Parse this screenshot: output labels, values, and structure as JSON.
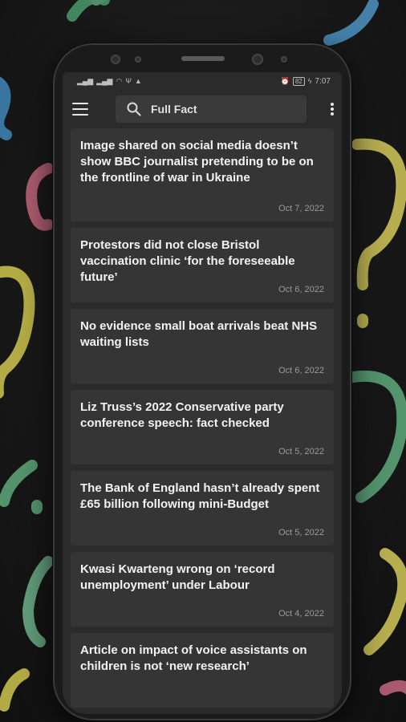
{
  "status": {
    "time": "7:07",
    "battery": "82"
  },
  "search": {
    "value": "Full Fact"
  },
  "articles": [
    {
      "title": "Image shared on social media doesn’t show BBC journalist pretending to be on the frontline of war in Ukraine",
      "date": "Oct 7, 2022"
    },
    {
      "title": "Protestors did not close Bristol vaccination clinic ‘for the foreseeable future’",
      "date": "Oct 6, 2022"
    },
    {
      "title": "No evidence small boat arrivals beat NHS waiting lists",
      "date": "Oct 6, 2022"
    },
    {
      "title": "Liz Truss’s 2022 Conservative party conference speech: fact checked",
      "date": "Oct 5, 2022"
    },
    {
      "title": "The Bank of England hasn’t already spent £65 billion following mini-Budget",
      "date": "Oct 5, 2022"
    },
    {
      "title": "Kwasi Kwarteng wrong on ‘record unemployment’ under Labour",
      "date": "Oct 4, 2022"
    },
    {
      "title": "Article on impact of voice assistants on children is not ‘new research’",
      "date": ""
    }
  ],
  "icons": {
    "menu": "hamburger-menu-icon",
    "search": "magnifier-icon",
    "more": "vertical-dots-icon"
  }
}
